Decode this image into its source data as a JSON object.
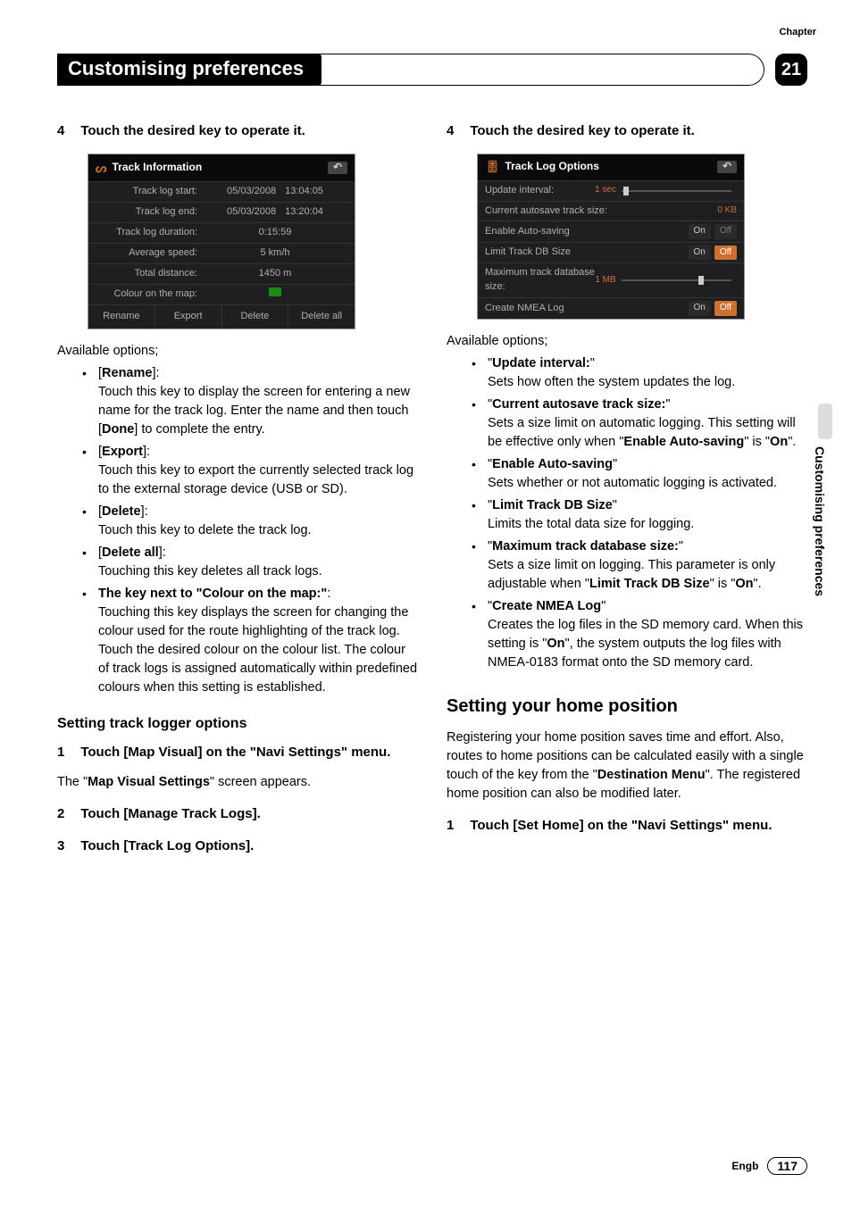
{
  "chapter": {
    "label": "Chapter",
    "number": "21"
  },
  "header": {
    "title": "Customising preferences"
  },
  "sideLabel": "Customising preferences",
  "footer": {
    "lang": "Engb",
    "page": "117"
  },
  "left": {
    "step4": {
      "num": "4",
      "text": "Touch the desired key to operate it."
    },
    "screenshot": {
      "title": "Track Information",
      "rows": [
        {
          "label": "Track log start:",
          "v1": "05/03/2008",
          "v2": "13:04:05"
        },
        {
          "label": "Track log end:",
          "v1": "05/03/2008",
          "v2": "13:20:04"
        }
      ],
      "singleRows": [
        {
          "label": "Track log duration:",
          "value": "0:15:59"
        },
        {
          "label": "Average speed:",
          "value": "5 km/h"
        },
        {
          "label": "Total distance:",
          "value": "1450 m"
        }
      ],
      "colourLabel": "Colour on the map:",
      "buttons": [
        "Rename",
        "Export",
        "Delete",
        "Delete all"
      ]
    },
    "available": "Available options;",
    "items": [
      {
        "key": "Rename",
        "bracket": true,
        "desc": "Touch this key to display the screen for entering a new name for the track log. Enter the name and then touch [",
        "boldInline": "Done",
        "descEnd": "] to complete the entry."
      },
      {
        "key": "Export",
        "bracket": true,
        "desc": "Touch this key to export the currently selected track log to the external storage device (USB or SD)."
      },
      {
        "key": "Delete",
        "bracket": true,
        "desc": "Touch this key to delete the track log."
      },
      {
        "key": "Delete all",
        "bracket": true,
        "desc": "Touching this key deletes all track logs."
      },
      {
        "key": "The key next to \"Colour on the map:\"",
        "bracket": false,
        "desc": "Touching this key displays the screen for changing the colour used for the route highlighting of the track log. Touch the desired colour on the colour list. The colour of track logs is assigned automatically within predefined colours when this setting is established."
      }
    ],
    "subHeading": "Setting track logger options",
    "step1": {
      "num": "1",
      "t1": "Touch [Map Visual] on the \"Navi Settings\" menu."
    },
    "step1After": {
      "t1": "The \"",
      "bold": "Map Visual Settings",
      "t2": "\" screen appears."
    },
    "step2": {
      "num": "2",
      "text": "Touch [Manage Track Logs]."
    },
    "step3": {
      "num": "3",
      "text": "Touch [Track Log Options]."
    }
  },
  "right": {
    "step4": {
      "num": "4",
      "text": "Touch the desired key to operate it."
    },
    "screenshot": {
      "title": "Track Log Options",
      "updateLabel": "Update interval:",
      "updateVal": "1 sec",
      "autoLabel": "Current autosave track size:",
      "autoVal": "0 KB",
      "toggles": [
        {
          "label": "Enable Auto-saving",
          "on": "On",
          "off": "Off",
          "activeOff": false
        },
        {
          "label": "Limit Track DB Size",
          "on": "On",
          "off": "Off",
          "activeOff": true
        }
      ],
      "dbLabel": "Maximum track database size:",
      "dbVal": "1 MB",
      "nmea": {
        "label": "Create NMEA Log",
        "on": "On",
        "off": "Off"
      }
    },
    "available": "Available options;",
    "items": [
      {
        "key": "Update interval:",
        "desc": "Sets how often the system updates the log."
      },
      {
        "key": "Current autosave track size:",
        "descParts": [
          "Sets a size limit on automatic logging. This setting will be effective only when \"",
          "Enable Auto-saving",
          "\" is \"",
          "On",
          "\"."
        ]
      },
      {
        "key": "Enable Auto-saving",
        "desc": "Sets whether or not automatic logging is activated."
      },
      {
        "key": "Limit Track DB Size",
        "desc": "Limits the total data size for logging."
      },
      {
        "key": "Maximum track database size:",
        "descParts": [
          "Sets a size limit on logging. This parameter is only adjustable when \"",
          "Limit Track DB Size",
          "\" is \"",
          "On",
          "\"."
        ]
      },
      {
        "key": "Create NMEA Log",
        "descParts": [
          "Creates the log files in the SD memory card. When this setting is \"",
          "On",
          "\", the system outputs the log files with NMEA-0183 format onto the SD memory card."
        ]
      }
    ],
    "section": "Setting your home position",
    "paraParts": [
      "Registering your home position saves time and effort. Also, routes to home positions can be calculated easily with a single touch of the key from the \"",
      "Destination Menu",
      "\". The registered home position can also be modified later."
    ],
    "step1": {
      "num": "1",
      "text": "Touch [Set Home] on the \"Navi Settings\" menu."
    }
  }
}
